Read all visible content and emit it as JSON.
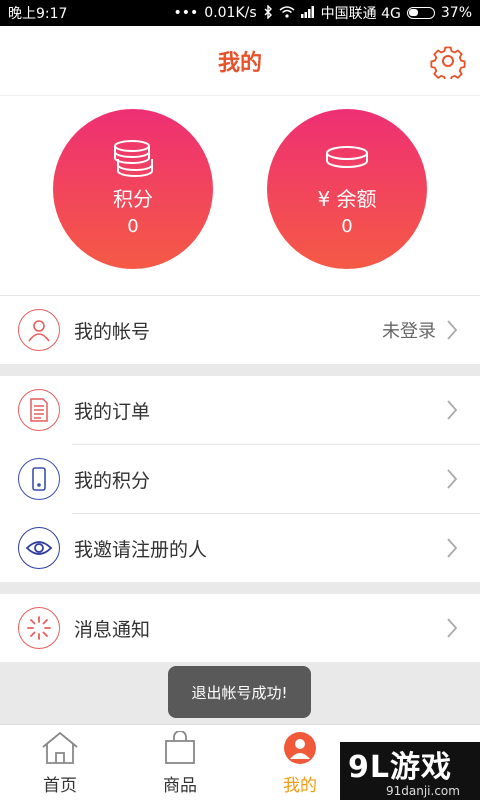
{
  "status_bar": {
    "time": "晚上9:17",
    "speed": "0.01K/s",
    "carrier": "中国联通 4G",
    "battery": "37%"
  },
  "header": {
    "title": "我的"
  },
  "stats": {
    "points_label": "积分",
    "points_value": "0",
    "balance_label": "¥ 余额",
    "balance_value": "0"
  },
  "account": {
    "label": "我的帐号",
    "status": "未登录"
  },
  "menu": [
    {
      "label": "我的订单"
    },
    {
      "label": "我的积分"
    },
    {
      "label": "我邀请注册的人"
    }
  ],
  "notify": {
    "label": "消息通知"
  },
  "toast": "退出帐号成功!",
  "bottom_nav": [
    {
      "label": "首页"
    },
    {
      "label": "商品"
    },
    {
      "label": "我的"
    },
    {
      "label": ""
    }
  ],
  "watermark": {
    "logo": "9L游戏",
    "url": "91danji.com"
  },
  "colors": {
    "accent": "#e8512a",
    "gradient_top": "#ee2f74",
    "gradient_bottom": "#f55a45",
    "active_nav": "#f39c12"
  }
}
